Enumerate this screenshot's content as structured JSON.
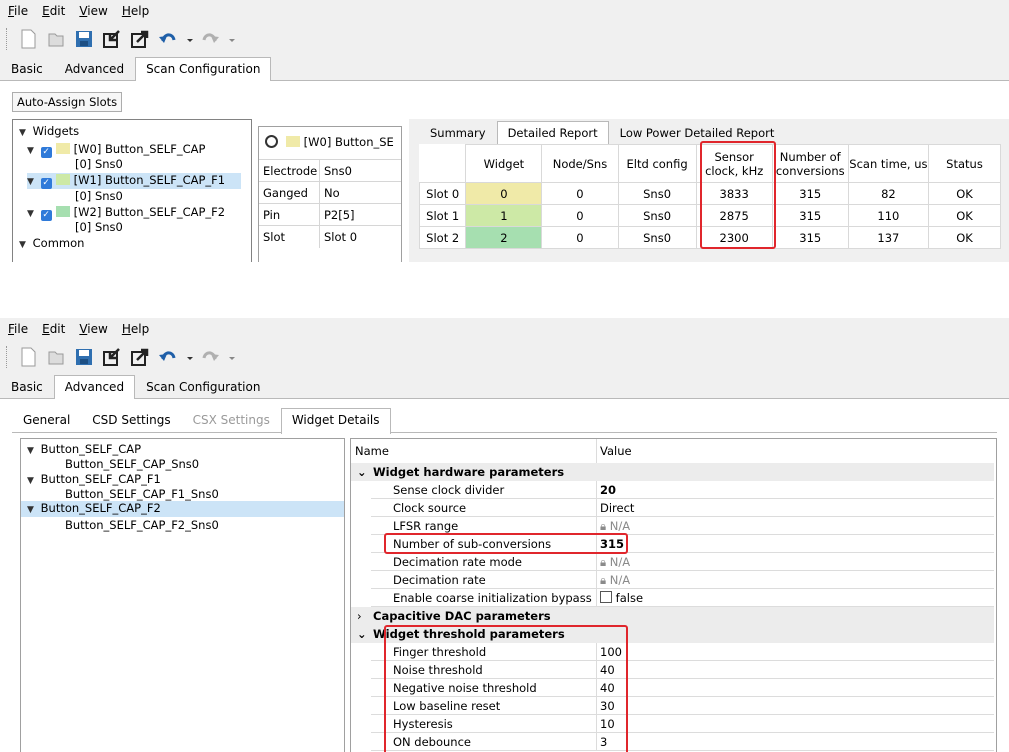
{
  "menu": [
    "File",
    "Edit",
    "View",
    "Help"
  ],
  "toolbar_icons": [
    "new-icon",
    "open-icon",
    "save-icon",
    "import-icon",
    "export-icon",
    "undo-icon",
    "redo-icon"
  ],
  "main_tabs": [
    "Basic",
    "Advanced",
    "Scan Configuration"
  ],
  "top": {
    "auto_assign": "Auto-Assign Slots",
    "tree": {
      "widgets": "Widgets",
      "w0": "[W0] Button_SELF_CAP",
      "w0_sns": "[0] Sns0",
      "w1": "[W1] Button_SELF_CAP_F1",
      "w1_sns": "[0] Sns0",
      "w2": "[W2] Button_SELF_CAP_F2",
      "w2_sns": "[0] Sns0",
      "common": "Common"
    },
    "slot_header": "[W0] Button_SE",
    "props": [
      {
        "k": "Electrode",
        "v": "Sns0"
      },
      {
        "k": "Ganged",
        "v": "No"
      },
      {
        "k": "Pin",
        "v": "P2[5]"
      },
      {
        "k": "Slot",
        "v": "Slot 0"
      }
    ],
    "report_tabs": [
      "Summary",
      "Detailed Report",
      "Low Power Detailed Report"
    ],
    "headers": [
      "Widget",
      "Node/Sns",
      "Eltd config",
      "Sensor clock, kHz",
      "Number of conversions",
      "Scan time, us",
      "Status"
    ],
    "rows": [
      {
        "slot": "Slot 0",
        "widget": "0",
        "node": "0",
        "eltd": "Sns0",
        "clock": "3833",
        "conv": "315",
        "time": "82",
        "status": "OK"
      },
      {
        "slot": "Slot 1",
        "widget": "1",
        "node": "0",
        "eltd": "Sns0",
        "clock": "2875",
        "conv": "315",
        "time": "110",
        "status": "OK"
      },
      {
        "slot": "Slot 2",
        "widget": "2",
        "node": "0",
        "eltd": "Sns0",
        "clock": "2300",
        "conv": "315",
        "time": "137",
        "status": "OK"
      }
    ],
    "colors": {
      "w0": "#f0eaa8",
      "w1": "#cde9a6",
      "w2": "#a6dfb0"
    }
  },
  "bottom": {
    "sub_tabs": [
      "General",
      "CSD Settings",
      "CSX Settings",
      "Widget Details"
    ],
    "tree": [
      {
        "label": "Button_SELF_CAP",
        "child": "Button_SELF_CAP_Sns0"
      },
      {
        "label": "Button_SELF_CAP_F1",
        "child": "Button_SELF_CAP_F1_Sns0"
      },
      {
        "label": "Button_SELF_CAP_F2",
        "child": "Button_SELF_CAP_F2_Sns0"
      }
    ],
    "grid_headers": {
      "name": "Name",
      "value": "Value"
    },
    "hw_group": "Widget hardware parameters",
    "hw": [
      {
        "name": "Sense clock divider",
        "value": "20",
        "bold": true
      },
      {
        "name": "Clock source",
        "value": "Direct"
      },
      {
        "name": "LFSR range",
        "value": "N/A",
        "locked": true
      },
      {
        "name": "Number of sub-conversions",
        "value": "315",
        "bold": true
      },
      {
        "name": "Decimation rate mode",
        "value": "N/A",
        "locked": true
      },
      {
        "name": "Decimation rate",
        "value": "N/A",
        "locked": true
      },
      {
        "name": "Enable coarse initialization bypass",
        "value": "false",
        "checkbox": true
      }
    ],
    "dac_group": "Capacitive DAC parameters",
    "th_group": "Widget threshold parameters",
    "th": [
      {
        "name": "Finger threshold",
        "value": "100"
      },
      {
        "name": "Noise threshold",
        "value": "40"
      },
      {
        "name": "Negative noise threshold",
        "value": "40"
      },
      {
        "name": "Low baseline reset",
        "value": "30"
      },
      {
        "name": "Hysteresis",
        "value": "10"
      },
      {
        "name": "ON debounce",
        "value": "3"
      }
    ]
  }
}
